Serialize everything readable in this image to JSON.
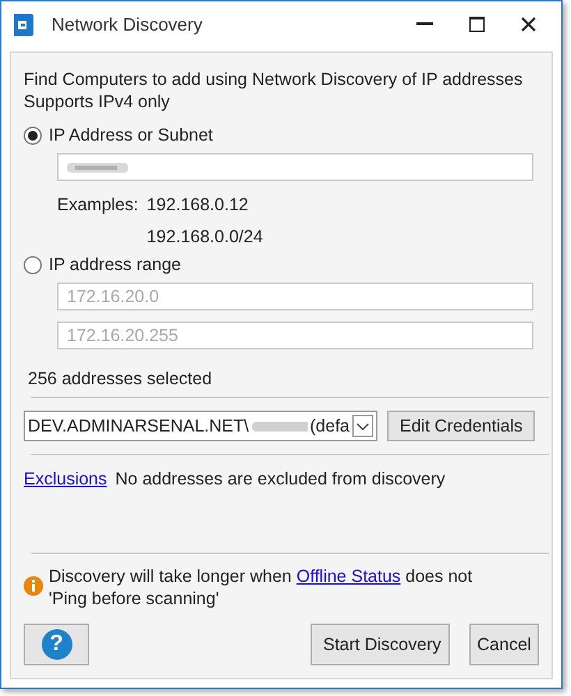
{
  "window": {
    "title": "Network Discovery"
  },
  "intro": [
    "Find Computers to add using Network Discovery of IP addresses",
    "Supports IPv4 only"
  ],
  "modes": [
    {
      "kind": "subnet",
      "label": "IP Address or Subnet",
      "selected": true,
      "examples_label": "Examples:",
      "examples": [
        "192.168.0.12",
        "192.168.0.0/24"
      ]
    },
    {
      "kind": "range",
      "label": "IP address range",
      "selected": false,
      "fields": [
        {
          "placeholder": "172.16.20.0"
        },
        {
          "placeholder": "172.16.20.255"
        }
      ]
    }
  ],
  "selection_count": "256 addresses selected",
  "credentials": {
    "value_start": "DEV.ADMINARSENAL.NET\\",
    "value_end": "(defa",
    "button": "Edit Credentials"
  },
  "exclusions": {
    "link": "Exclusions",
    "text": "No addresses are excluded from discovery"
  },
  "warning": {
    "before": "Discovery will take longer when ",
    "link": "Offline Status",
    "after": " does not 'Ping before scanning'"
  },
  "buttons": {
    "help": "?",
    "start": "Start Discovery",
    "cancel": "Cancel"
  }
}
